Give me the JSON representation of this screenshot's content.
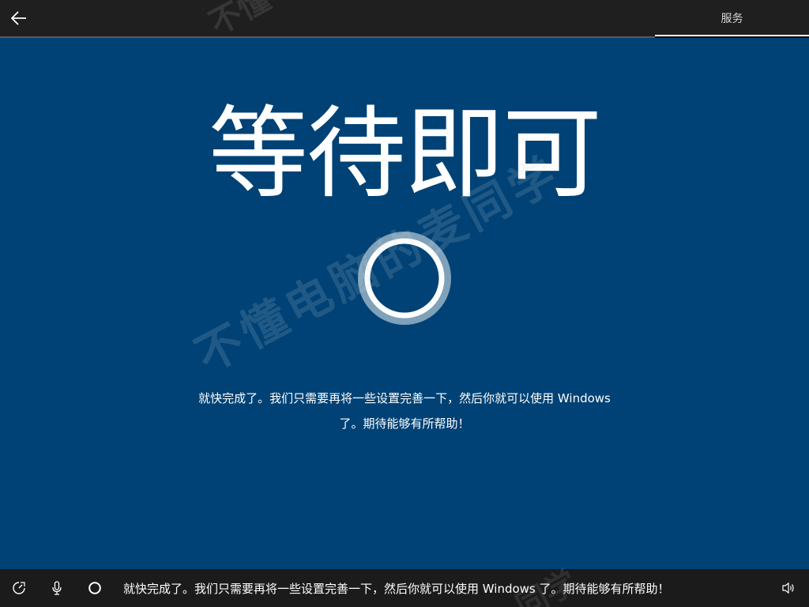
{
  "header": {
    "back_icon": "arrow-left-icon",
    "tab_label": "服务"
  },
  "main": {
    "heading": "等待即可",
    "message_line1": "就快完成了。我们只需要再将一些设置完善一下，然后你就可以使用 Windows",
    "message_line2": "了。期待能够有所帮助！",
    "spinner_icon": "loading-ring-icon",
    "watermark": "不懂电脑的麦同学",
    "background_color": "#004275"
  },
  "footer": {
    "icons": [
      "ease-of-access-icon",
      "microphone-icon",
      "cortana-ring-icon",
      "volume-icon"
    ],
    "caption": "就快完成了。我们只需要再将一些设置完善一下，然后你就可以使用 Windows 了。期待能够有所帮助！"
  }
}
